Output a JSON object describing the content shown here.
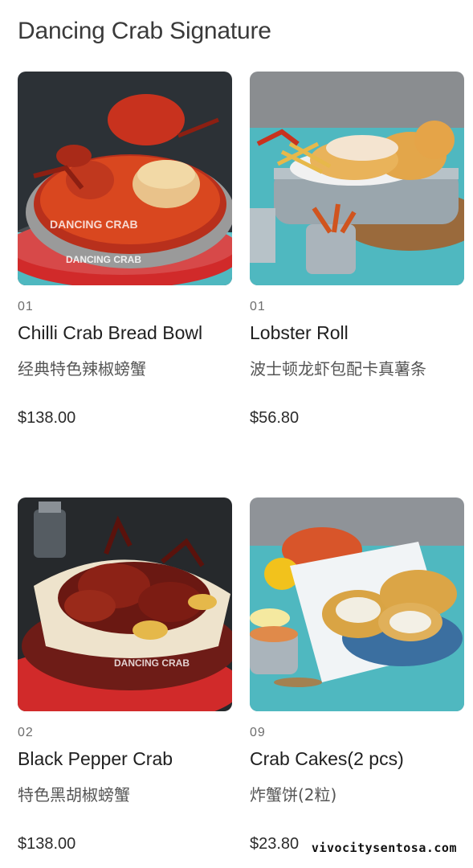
{
  "section": {
    "title": "Dancing Crab Signature"
  },
  "items": [
    {
      "number": "01",
      "name": "Chilli Crab Bread Bowl",
      "name_cn": "经典特色辣椒螃蟹",
      "price": "$138.00",
      "image": "chilli-crab-bread-bowl-photo"
    },
    {
      "number": "01",
      "name": "Lobster Roll",
      "name_cn": "波士顿龙虾包配卡真薯条",
      "price": "$56.80",
      "image": "lobster-roll-photo"
    },
    {
      "number": "02",
      "name": "Black Pepper Crab",
      "name_cn": "特色黑胡椒螃蟹",
      "price": "$138.00",
      "image": "black-pepper-crab-photo"
    },
    {
      "number": "09",
      "name": "Crab Cakes(2 pcs)",
      "name_cn": "炸蟹饼(2粒)",
      "price": "$23.80",
      "image": "crab-cakes-photo"
    }
  ],
  "watermark": "vivocitysentosa.com",
  "colors": {
    "teal": "#4fb8c0",
    "crab_red": "#c8321e",
    "plate_red": "#d12a2a",
    "bg": "#ffffff"
  }
}
